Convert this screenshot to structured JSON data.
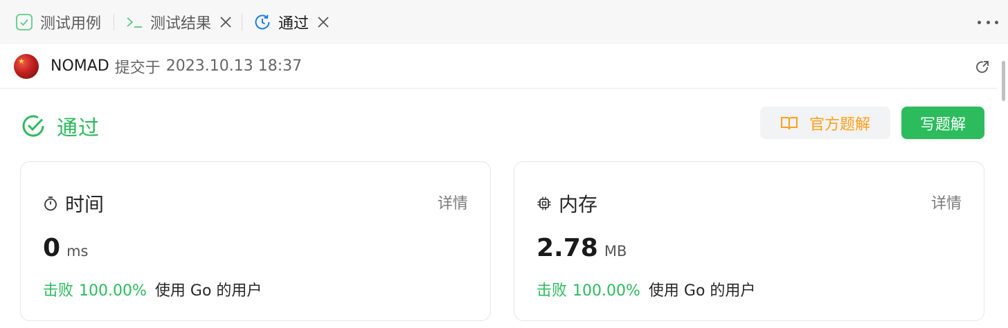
{
  "tabs": [
    {
      "label": "测试用例",
      "icon": "checkbox-icon",
      "active": false
    },
    {
      "label": "测试结果",
      "icon": "terminal-icon",
      "active": false
    },
    {
      "label": "通过",
      "icon": "clock-refresh-icon",
      "active": true
    }
  ],
  "submission": {
    "user": "NOMAD",
    "submitted_text": "提交于",
    "time": "2023.10.13 18:37"
  },
  "status": {
    "text": "通过",
    "color": "#2cbb5d"
  },
  "actions": {
    "official_solution": "官方题解",
    "write_solution": "写题解"
  },
  "cards": {
    "time": {
      "title": "时间",
      "detail": "详情",
      "value": "0",
      "unit": "ms",
      "beat_label": "击败",
      "beat_percent": "100.00%",
      "beat_suffix": "使用 Go 的用户"
    },
    "memory": {
      "title": "内存",
      "detail": "详情",
      "value": "2.78",
      "unit": "MB",
      "beat_label": "击败",
      "beat_percent": "100.00%",
      "beat_suffix": "使用 Go 的用户"
    }
  },
  "colors": {
    "accent_green": "#2cbb5d",
    "accent_orange": "#ff9f1a",
    "active_tab_icon": "#1a7cf0"
  }
}
